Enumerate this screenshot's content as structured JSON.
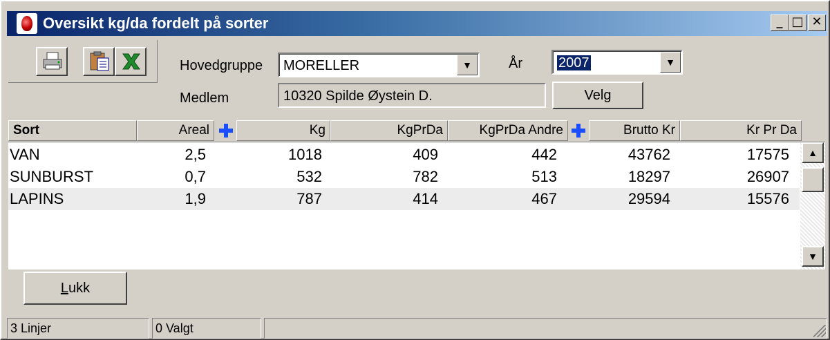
{
  "window": {
    "title": "Oversikt kg/da fordelt på sorter",
    "minimize": "_",
    "maximize": "□",
    "close": "✕"
  },
  "toolbar": {
    "icons": [
      "printer-icon",
      "clipboard-icon",
      "excel-icon"
    ]
  },
  "filters": {
    "hovedgruppe_label": "Hovedgruppe",
    "hovedgruppe_value": "MORELLER",
    "aar_label": "År",
    "aar_value": "2007",
    "medlem_label": "Medlem",
    "medlem_value": "10320 Spilde Øystein D.",
    "velg_label": "Velg"
  },
  "grid": {
    "columns": [
      "Sort",
      "Areal",
      "Kg",
      "KgPrDa",
      "KgPrDa Andre",
      "Brutto Kr",
      "Kr Pr Da"
    ],
    "rows": [
      [
        "VAN",
        "2,5",
        "1018",
        "409",
        "442",
        "43762",
        "17575"
      ],
      [
        "SUNBURST",
        "0,7",
        "532",
        "782",
        "513",
        "18297",
        "26907"
      ],
      [
        "LAPINS",
        "1,9",
        "787",
        "414",
        "467",
        "29594",
        "15576"
      ]
    ]
  },
  "actions": {
    "lukk_prefix": "L",
    "lukk_rest": "ukk"
  },
  "status": {
    "lines": "3 Linjer",
    "selected": "0 Valgt",
    "extra": ""
  },
  "colors": {
    "face": "#d4d0c8",
    "title_start": "#0a246a",
    "title_end": "#a6caf0",
    "plus_blue": "#1a4dff",
    "selection": "#0a246a"
  }
}
